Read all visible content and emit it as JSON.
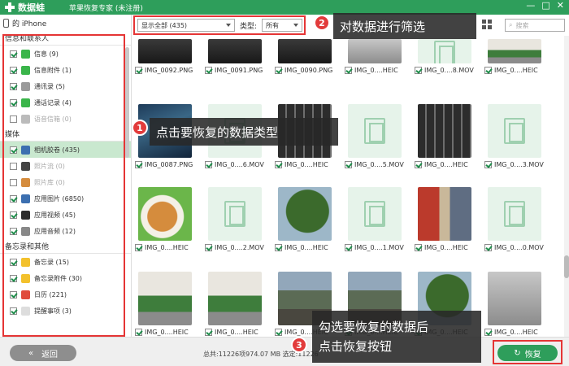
{
  "titlebar": {
    "logo_text": "数据蛙",
    "title": "苹果恢复专家 (未注册)",
    "controls": [
      "—",
      "□",
      "✕"
    ]
  },
  "device": {
    "name": "的 iPhone"
  },
  "sidebar": {
    "sections": [
      {
        "title": "信息和联系人",
        "items": [
          {
            "label": "信息 (9)",
            "checked": true,
            "disabled": false,
            "icon": "messages-icon",
            "color": "#3ab54a"
          },
          {
            "label": "信息附件 (1)",
            "checked": true,
            "disabled": false,
            "icon": "attachment-icon",
            "color": "#3ab54a"
          },
          {
            "label": "通讯录 (5)",
            "checked": true,
            "disabled": false,
            "icon": "contacts-icon",
            "color": "#9a9a9a"
          },
          {
            "label": "通话记录 (4)",
            "checked": true,
            "disabled": false,
            "icon": "phone-icon",
            "color": "#3ab54a"
          },
          {
            "label": "语音信箱 (0)",
            "checked": false,
            "disabled": true,
            "icon": "voicemail-icon",
            "color": "#bbbbbb"
          }
        ]
      },
      {
        "title": "媒体",
        "items": [
          {
            "label": "相机胶卷 (435)",
            "checked": true,
            "disabled": false,
            "selected": true,
            "icon": "camera-icon",
            "color": "#3c6fb0"
          },
          {
            "label": "照片流 (0)",
            "checked": false,
            "disabled": true,
            "icon": "photo-stream-icon",
            "color": "#444444"
          },
          {
            "label": "照片库 (0)",
            "checked": false,
            "disabled": true,
            "icon": "photo-library-icon",
            "color": "#d58c3d"
          },
          {
            "label": "应用图片 (6850)",
            "checked": true,
            "disabled": false,
            "icon": "app-photos-icon",
            "color": "#3c6fb0"
          },
          {
            "label": "应用视频 (45)",
            "checked": true,
            "disabled": false,
            "icon": "app-videos-icon",
            "color": "#2b2b2b"
          },
          {
            "label": "应用音频 (12)",
            "checked": true,
            "disabled": false,
            "icon": "app-audio-icon",
            "color": "#888888"
          }
        ]
      },
      {
        "title": "备忘录和其他",
        "items": [
          {
            "label": "备忘录 (15)",
            "checked": true,
            "disabled": false,
            "icon": "notes-icon",
            "color": "#f3c12c"
          },
          {
            "label": "备忘录附件 (30)",
            "checked": true,
            "disabled": false,
            "icon": "notes-attachment-icon",
            "color": "#f3c12c"
          },
          {
            "label": "日历 (221)",
            "checked": true,
            "disabled": false,
            "icon": "calendar-icon",
            "color": "#e04b3b"
          },
          {
            "label": "提醒事项 (3)",
            "checked": true,
            "disabled": false,
            "icon": "reminders-icon",
            "color": "#dddddd"
          }
        ]
      }
    ]
  },
  "toolbar": {
    "filter_value": "显示全部 (435)",
    "type_label": "类型:",
    "type_value": "所有",
    "search_placeholder": "搜索"
  },
  "thumbnails": [
    {
      "name": "IMG_0092.PNG",
      "kind": "photo-dark"
    },
    {
      "name": "IMG_0091.PNG",
      "kind": "photo-dark"
    },
    {
      "name": "IMG_0090.PNG",
      "kind": "photo-dark"
    },
    {
      "name": "IMG_0....HEIC",
      "kind": "photo-room"
    },
    {
      "name": "IMG_0....8.MOV",
      "kind": "video"
    },
    {
      "name": "IMG_0....HEIC",
      "kind": "photo-plant"
    },
    {
      "name": "IMG_0087.PNG",
      "kind": "photo-ios"
    },
    {
      "name": "IMG_0....6.MOV",
      "kind": "video"
    },
    {
      "name": "IMG_0....HEIC",
      "kind": "photo-keys"
    },
    {
      "name": "IMG_0....5.MOV",
      "kind": "video"
    },
    {
      "name": "IMG_0....HEIC",
      "kind": "photo-keys"
    },
    {
      "name": "IMG_0....3.MOV",
      "kind": "video"
    },
    {
      "name": "IMG_0....HEIC",
      "kind": "photo-food"
    },
    {
      "name": "IMG_0....2.MOV",
      "kind": "video"
    },
    {
      "name": "IMG_0....HEIC",
      "kind": "photo-tree"
    },
    {
      "name": "IMG_0....1.MOV",
      "kind": "video"
    },
    {
      "name": "IMG_0....HEIC",
      "kind": "photo-store"
    },
    {
      "name": "IMG_0....0.MOV",
      "kind": "video"
    },
    {
      "name": "IMG_0....HEIC",
      "kind": "photo-plant"
    },
    {
      "name": "IMG_0....HEIC",
      "kind": "photo-plant"
    },
    {
      "name": "IMG_0....HEIC",
      "kind": "photo-city"
    },
    {
      "name": "IMG_0....HEIC",
      "kind": "photo-city"
    },
    {
      "name": "IMG_0....HEIC",
      "kind": "photo-tree"
    },
    {
      "name": "IMG_0....HEIC",
      "kind": "photo-room"
    }
  ],
  "bottom": {
    "back_label": "返回",
    "back_arrow": "«",
    "stats": "总共:11226项974.07 MB 选定:11226",
    "recover_label": "恢复",
    "recover_icon": "↻"
  },
  "annotations": [
    {
      "number": "1",
      "text": "点击要恢复的数据类型"
    },
    {
      "number": "2",
      "text": "对数据进行筛选"
    },
    {
      "number": "3",
      "text": "勾选要恢复的数据后\n点击恢复按钮"
    }
  ],
  "colors": {
    "brand": "#2e9e5b",
    "highlight": "#e53535",
    "selected_row": "#c9e8cf"
  }
}
